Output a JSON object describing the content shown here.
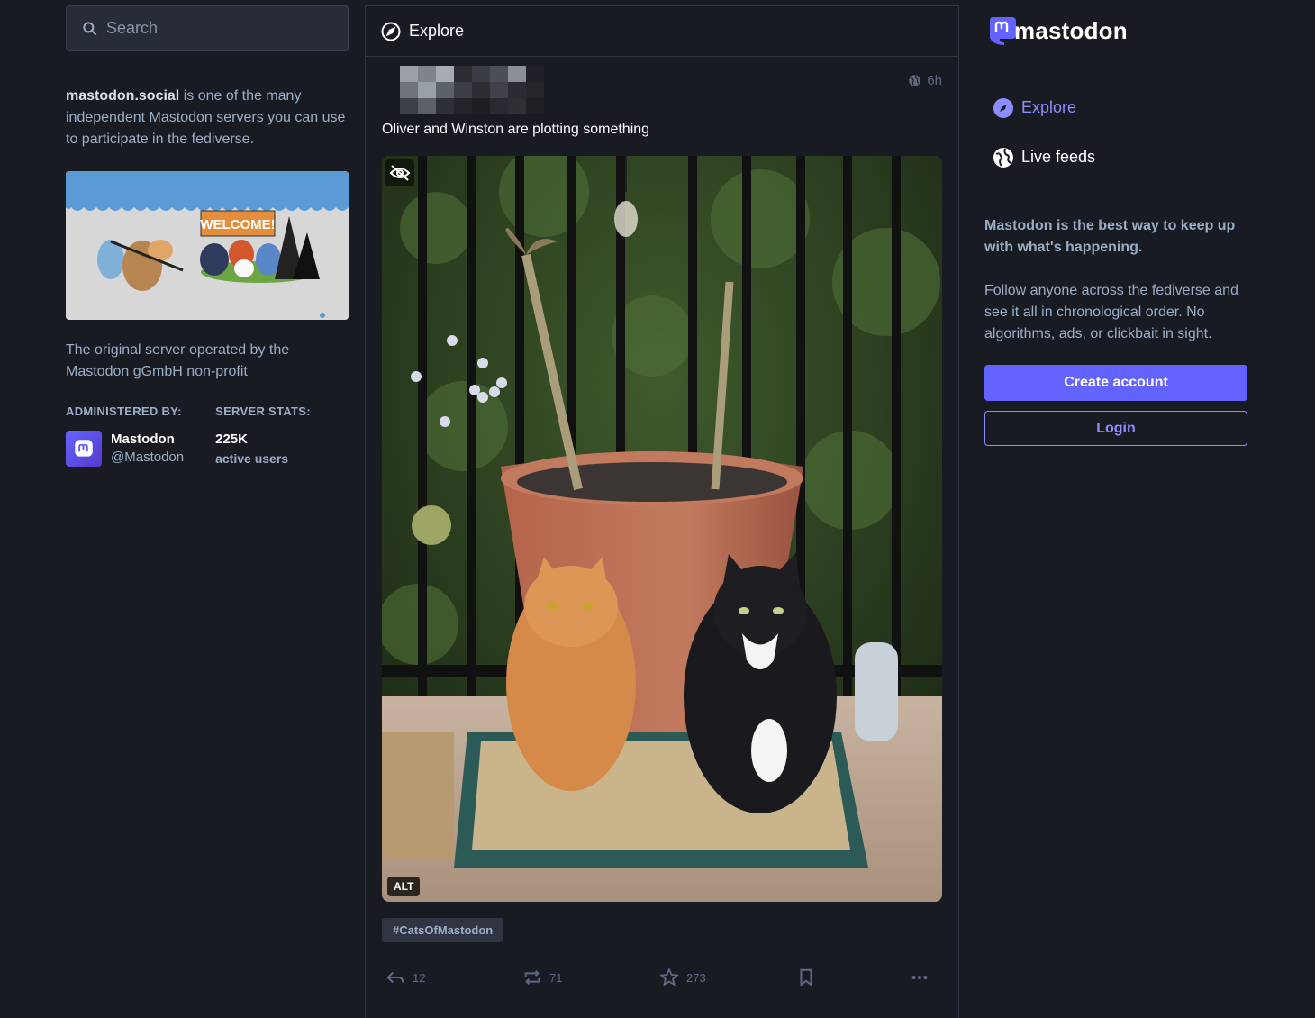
{
  "search": {
    "placeholder": "Search"
  },
  "about": {
    "server_name": "mastodon.social",
    "server_tagline": " is one of the many independent Mastodon servers you can use to participate in the fediverse.",
    "description": "The original server operated by the Mastodon gGmbH non-profit",
    "hero_sign": "WELCOME!",
    "administered_heading": "Administered by:",
    "admin_name": "Mastodon",
    "admin_handle": "@Mastodon",
    "stats_heading": "Server stats:",
    "stats_value": "225K",
    "stats_label": "active users"
  },
  "column": {
    "title": "Explore"
  },
  "status": {
    "time": "6h",
    "text": "Oliver and Winston are plotting something",
    "alt_badge": "ALT",
    "hashtag": "#CatsOfMastodon",
    "replies": "12",
    "boosts": "71",
    "favourites": "273"
  },
  "brand": {
    "wordmark": "mastodon"
  },
  "nav": {
    "explore": "Explore",
    "live_feeds": "Live feeds"
  },
  "promo": {
    "title": "Mastodon is the best way to keep up with what's happening.",
    "body": "Follow anyone across the fediverse and see it all in chronological order. No algorithms, ads, or clickbait in sight.",
    "create_account": "Create account",
    "login": "Login"
  },
  "colors": {
    "background": "#191b22",
    "accent": "#6364ff",
    "accent_text": "#8c8dff",
    "muted_text": "#9baec8"
  }
}
